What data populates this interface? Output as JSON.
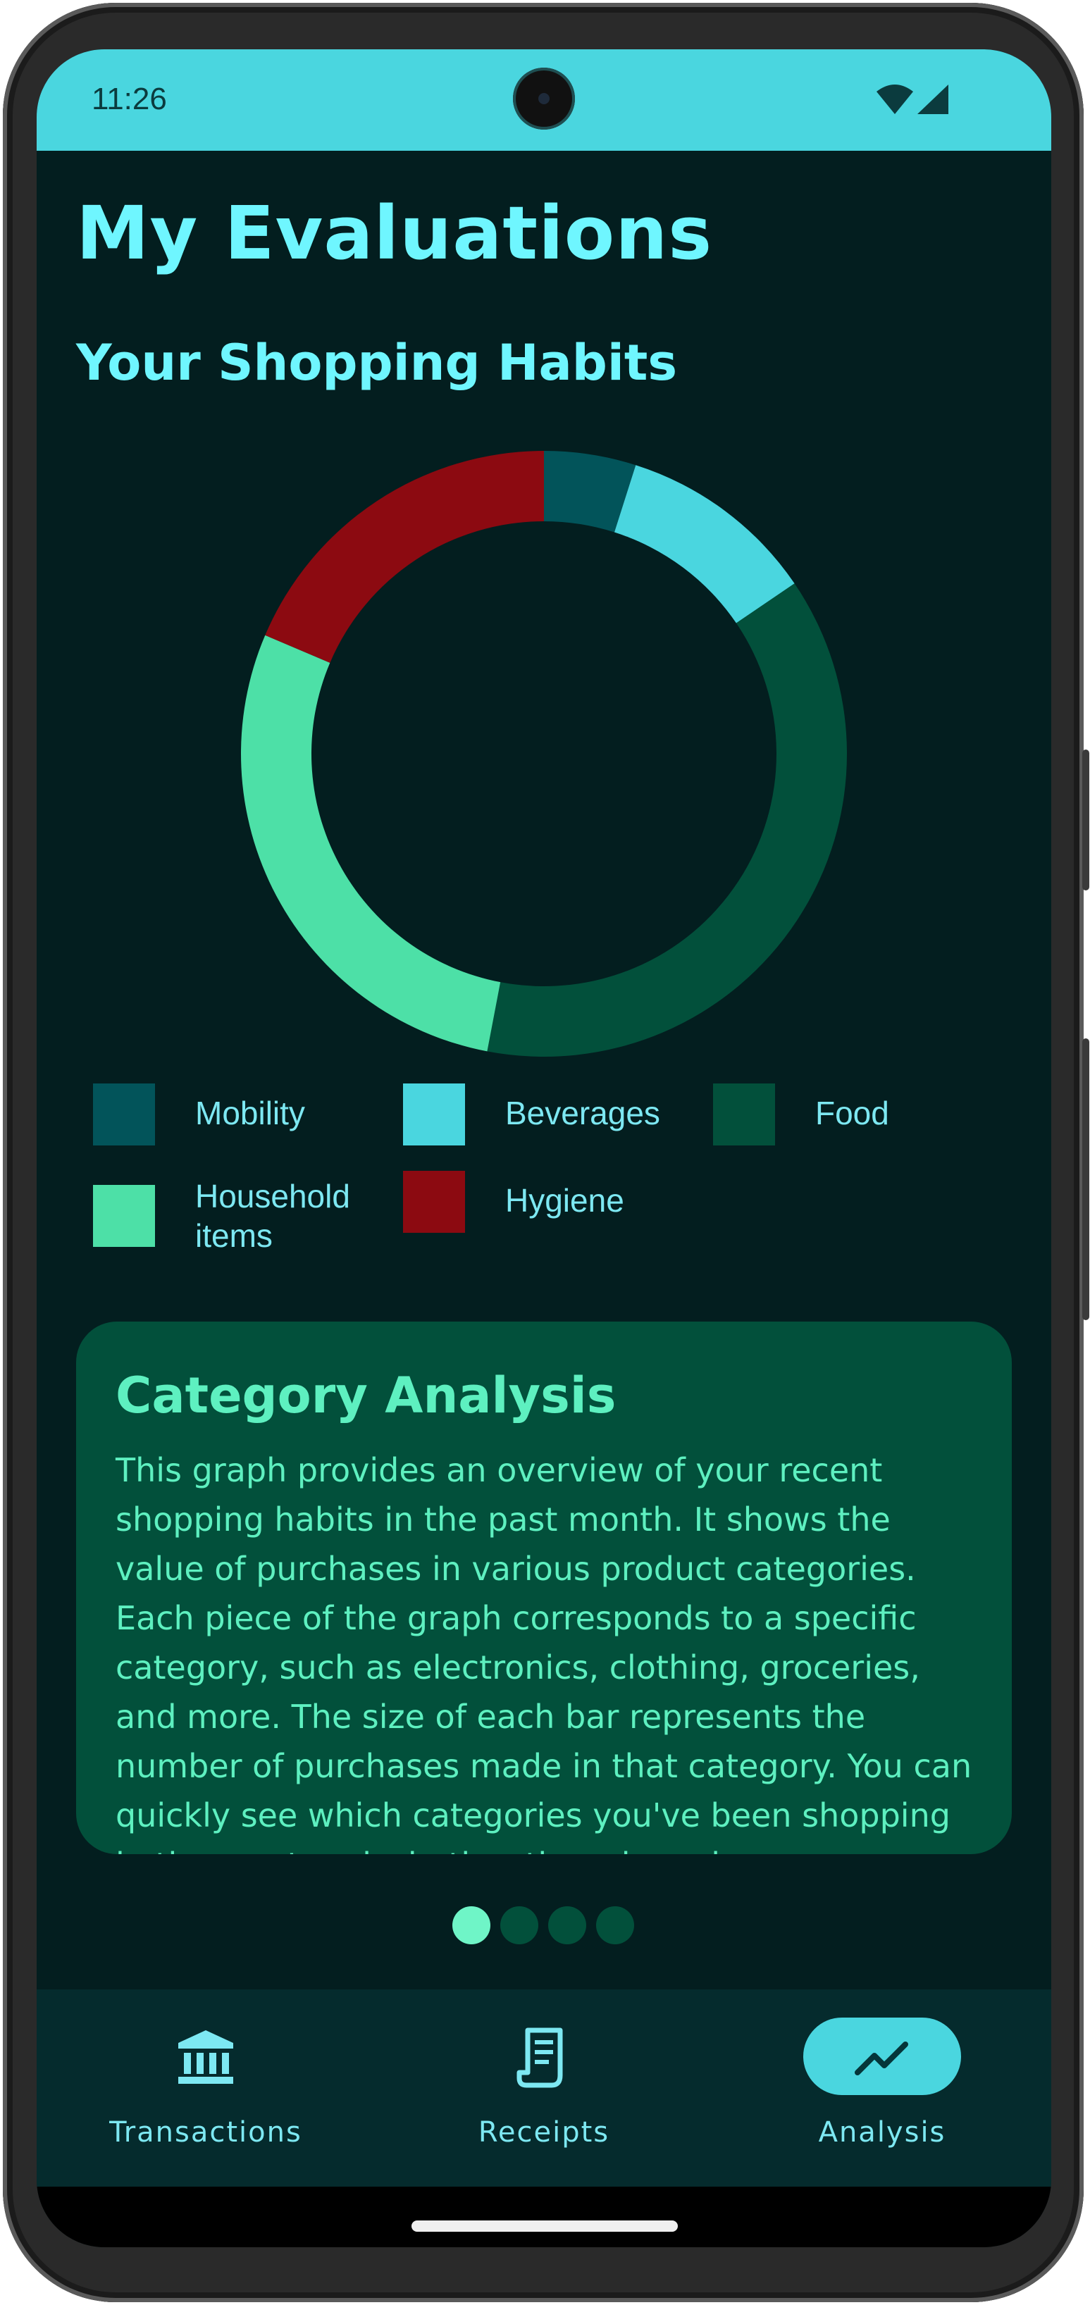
{
  "status_bar": {
    "time": "11:26",
    "wifi_icon": "wifi-icon",
    "signal_icon": "cell-signal-icon"
  },
  "page": {
    "title": "My Evaluations",
    "subtitle": "Your Shopping Habits"
  },
  "chart_data": {
    "type": "pie",
    "subtype": "donut",
    "title": "",
    "slices": [
      {
        "label": "Mobility",
        "value": 4.9,
        "color": "#02545a"
      },
      {
        "label": "Beverages",
        "value": 10.6,
        "color": "#4ad6df"
      },
      {
        "label": "Food",
        "value": 37.5,
        "color": "#02503b"
      },
      {
        "label": "Household items",
        "value": 28.4,
        "color": "#4de0a7"
      },
      {
        "label": "Hygiene",
        "value": 18.6,
        "color": "#8c0a11"
      }
    ],
    "legend_position": "bottom"
  },
  "legend": [
    {
      "label": "Mobility",
      "color": "#02545a"
    },
    {
      "label": "Beverages",
      "color": "#4ad6df"
    },
    {
      "label": "Food",
      "color": "#02503b"
    },
    {
      "label": "Household items",
      "color": "#4de0a7"
    },
    {
      "label": "Hygiene",
      "color": "#8c0a11"
    }
  ],
  "card": {
    "title": "Category Analysis",
    "body": "This graph provides an overview of your recent shopping habits in the past month. It shows the value of purchases in various product categories. Each piece of the graph corresponds to a specific category, such as electronics, clothing, groceries, and more. The size of each bar represents the number of purchases made in that category. You can quickly see which categories you've been shopping in the most and whether there have been"
  },
  "pager": {
    "count": 4,
    "active_index": 0
  },
  "nav": {
    "items": [
      {
        "label": "Transactions",
        "icon": "bank-icon",
        "active": false
      },
      {
        "label": "Receipts",
        "icon": "receipt-icon",
        "active": false
      },
      {
        "label": "Analysis",
        "icon": "trending-up-icon",
        "active": true
      }
    ]
  },
  "colors": {
    "background": "#031e1f",
    "accent": "#4ad6df",
    "title": "#6ff6ff",
    "card": "#02503b",
    "card_text": "#5ef0c0"
  }
}
